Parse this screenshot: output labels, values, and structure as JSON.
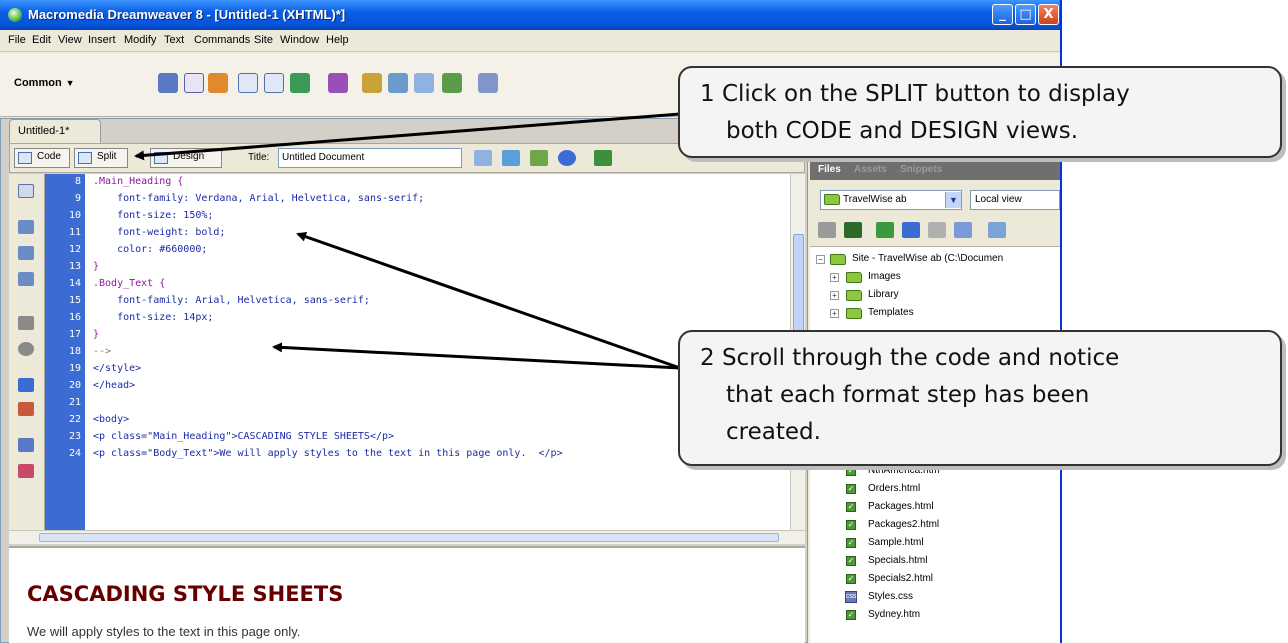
{
  "window": {
    "title": "Macromedia Dreamweaver 8 - [Untitled-1 (XHTML)*]",
    "controls": {
      "minimize": "_",
      "maximize": "□",
      "close": "X"
    }
  },
  "menubar": {
    "items": [
      "File",
      "Edit",
      "View",
      "Insert",
      "Modify",
      "Text",
      "Commands",
      "Site",
      "Window",
      "Help"
    ]
  },
  "insertbar": {
    "category": "Common",
    "chevron": "▼"
  },
  "document": {
    "tab": "Untitled-1*",
    "views": {
      "code": "Code",
      "split": "Split",
      "design": "Design"
    },
    "title_label": "Title:",
    "title_value": "Untitled Document"
  },
  "code": {
    "line_numbers": [
      "8",
      "9",
      "10",
      "11",
      "12",
      "13",
      "14",
      "15",
      "16",
      "17",
      "18",
      "19",
      "20",
      "21",
      "22",
      "23",
      "24"
    ],
    "lines": [
      ".Main_Heading {",
      "    font-family: Verdana, Arial, Helvetica, sans-serif;",
      "    font-size: 150%;",
      "    font-weight: bold;",
      "    color: #660000;",
      "}",
      ".Body_Text {",
      "    font-family: Arial, Helvetica, sans-serif;",
      "    font-size: 14px;",
      "}",
      "-->",
      "</style>",
      "</head>",
      "",
      "<body>",
      "<p class=\"Main_Heading\">CASCADING STYLE SHEETS</p>",
      "<p class=\"Body_Text\">We will apply styles to the text in this page only.  </p>"
    ]
  },
  "design": {
    "heading": "CASCADING STYLE SHEETS",
    "body": "We will apply styles to the text in this page only."
  },
  "files_panel": {
    "tabs": [
      "Files",
      "Assets",
      "Snippets"
    ],
    "site": "TravelWise ab",
    "view": "Local view",
    "tree": {
      "root": "Site - TravelWise ab (C:\\Documen",
      "folders": [
        "Images",
        "Library",
        "Templates"
      ],
      "files": [
        "NthAmerica.htm",
        "Orders.html",
        "Packages.html",
        "Packages2.html",
        "Sample.html",
        "Specials.html",
        "Specials2.html",
        "Styles.css",
        "Sydney.htm"
      ]
    }
  },
  "callouts": {
    "step1": {
      "line1": "1  Click on the SPLIT button to display",
      "line2": "both CODE and DESIGN views."
    },
    "step2": {
      "line1": "2  Scroll through the code and notice",
      "line2": "that each format step has been",
      "line3": "created."
    }
  },
  "colors": {
    "titlebar": "#0a5fe4",
    "line_gutter": "#3c6bd3",
    "heading_color": "#660000",
    "selector_color": "#8a1a9a",
    "property_color": "#1b2aa8"
  }
}
